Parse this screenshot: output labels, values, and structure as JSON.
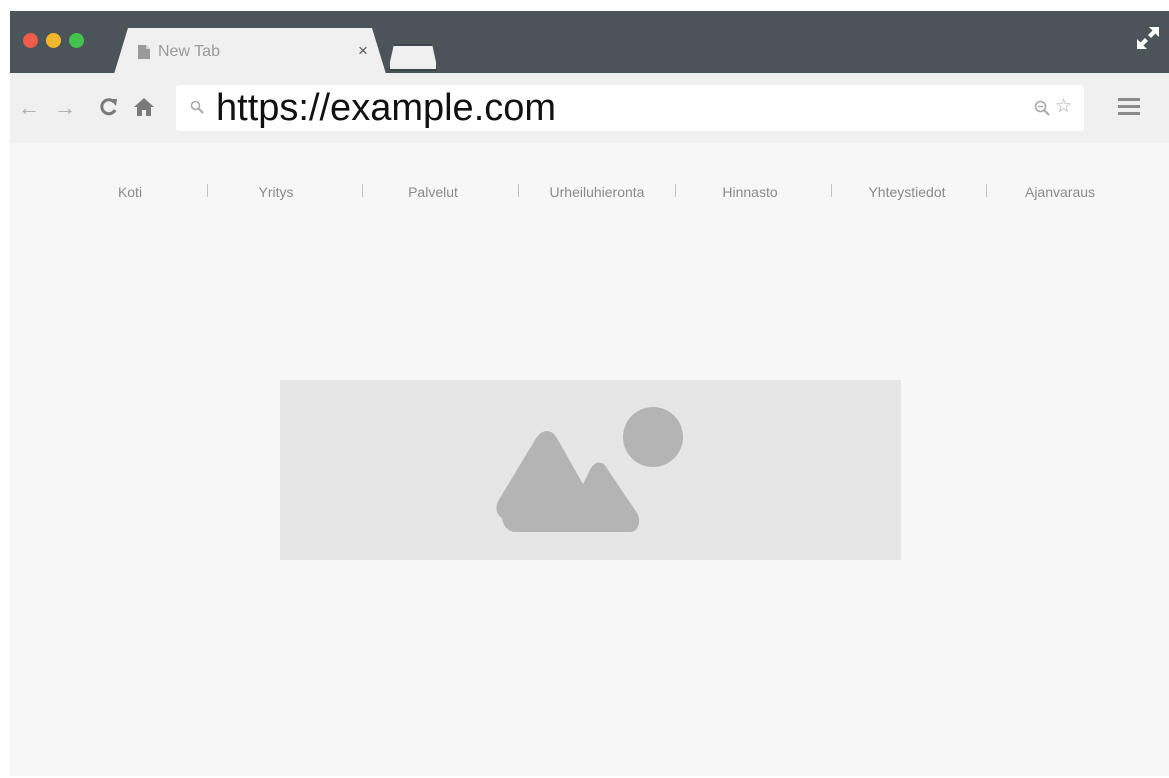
{
  "browser": {
    "tab": {
      "title": "New Tab",
      "close_glyph": "×",
      "icon": "document-icon"
    },
    "url": "https://example.com",
    "nav": {
      "back_glyph": "←",
      "forward_glyph": "→",
      "star_glyph": "☆"
    },
    "window_controls": [
      "close",
      "minimize",
      "maximize"
    ],
    "colors": {
      "frame": "#4a5459",
      "toolbar": "#f0f0f0",
      "page_bg": "#f7f7f7",
      "close_dot": "#ee5c4b",
      "minimize_dot": "#f3b72e",
      "maximize_dot": "#46c34e"
    }
  },
  "site": {
    "nav_items": [
      "Koti",
      "Yritys",
      "Palvelut",
      "Urheiluhieronta",
      "Hinnasto",
      "Yhteystiedot",
      "Ajanvaraus"
    ],
    "hero_image": {
      "type": "image-placeholder",
      "icon": "mountain-sun-icon",
      "color": "#e6e6e6"
    }
  }
}
